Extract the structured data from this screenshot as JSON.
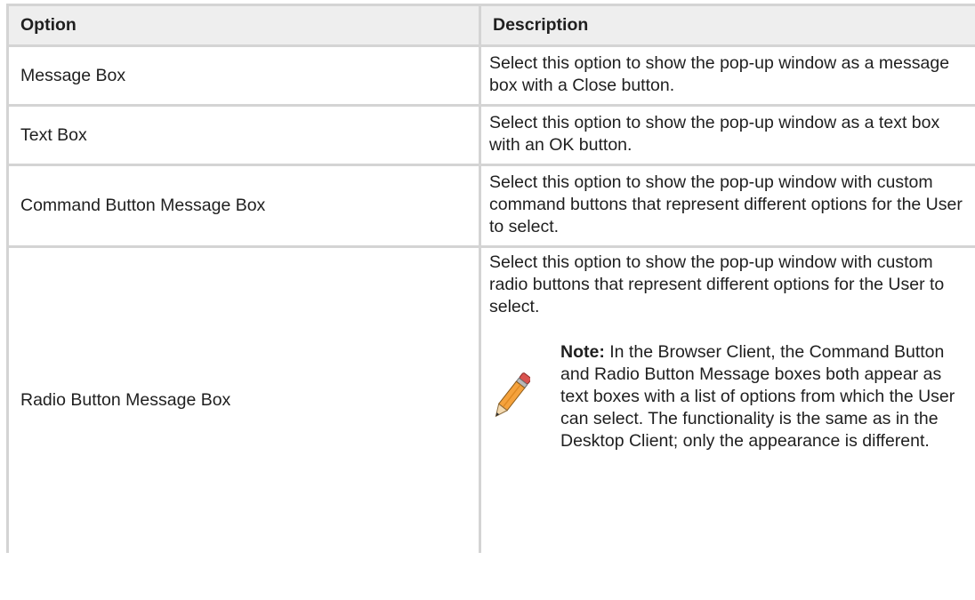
{
  "header": {
    "option": "Option",
    "description": "Description"
  },
  "rows": [
    {
      "option": "Message Box",
      "description": "Select this option to show the pop-up window as a message box with a Close button."
    },
    {
      "option": "Text Box",
      "description": "Select this option to show the pop-up window as a text box with an OK button."
    },
    {
      "option": "Command Button Message Box",
      "description": "Select this option to show the pop-up window with custom command buttons that represent different options for the User to select."
    },
    {
      "option": "Radio Button Message Box",
      "description": "Select this option to show the pop-up window with custom radio buttons that represent different options for the User to select.",
      "note": {
        "icon": "pencil-icon",
        "label": "Note:",
        "text": " In the Browser Client, the Command Button and Radio Button Message boxes both appear as text boxes with a list of options from which the User can select. The functionality is the same as in the Desktop Client; only the appearance is different."
      }
    }
  ]
}
